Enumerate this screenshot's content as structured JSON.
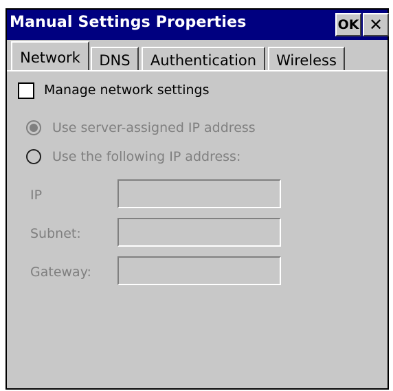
{
  "window": {
    "title": "Manual Settings Properties",
    "ok_label": "OK",
    "close_label": "✕"
  },
  "tabs": [
    {
      "label": "Network",
      "active": true
    },
    {
      "label": "DNS",
      "active": false
    },
    {
      "label": "Authentication",
      "active": false
    },
    {
      "label": "Wireless",
      "active": false
    }
  ],
  "network": {
    "manage_label": "Manage network settings",
    "manage_checked": false,
    "radio_server_label": "Use server-assigned IP address",
    "radio_server_selected": true,
    "radio_static_label": "Use the following IP address:",
    "radio_static_selected": false,
    "ip_label": "IP",
    "ip_value": "",
    "subnet_label": "Subnet:",
    "subnet_value": "",
    "gateway_label": "Gateway:",
    "gateway_value": ""
  },
  "colors": {
    "titlebar": "#000080",
    "dialog_bg": "#c8c8c8",
    "disabled_text": "#7f7f7f"
  }
}
